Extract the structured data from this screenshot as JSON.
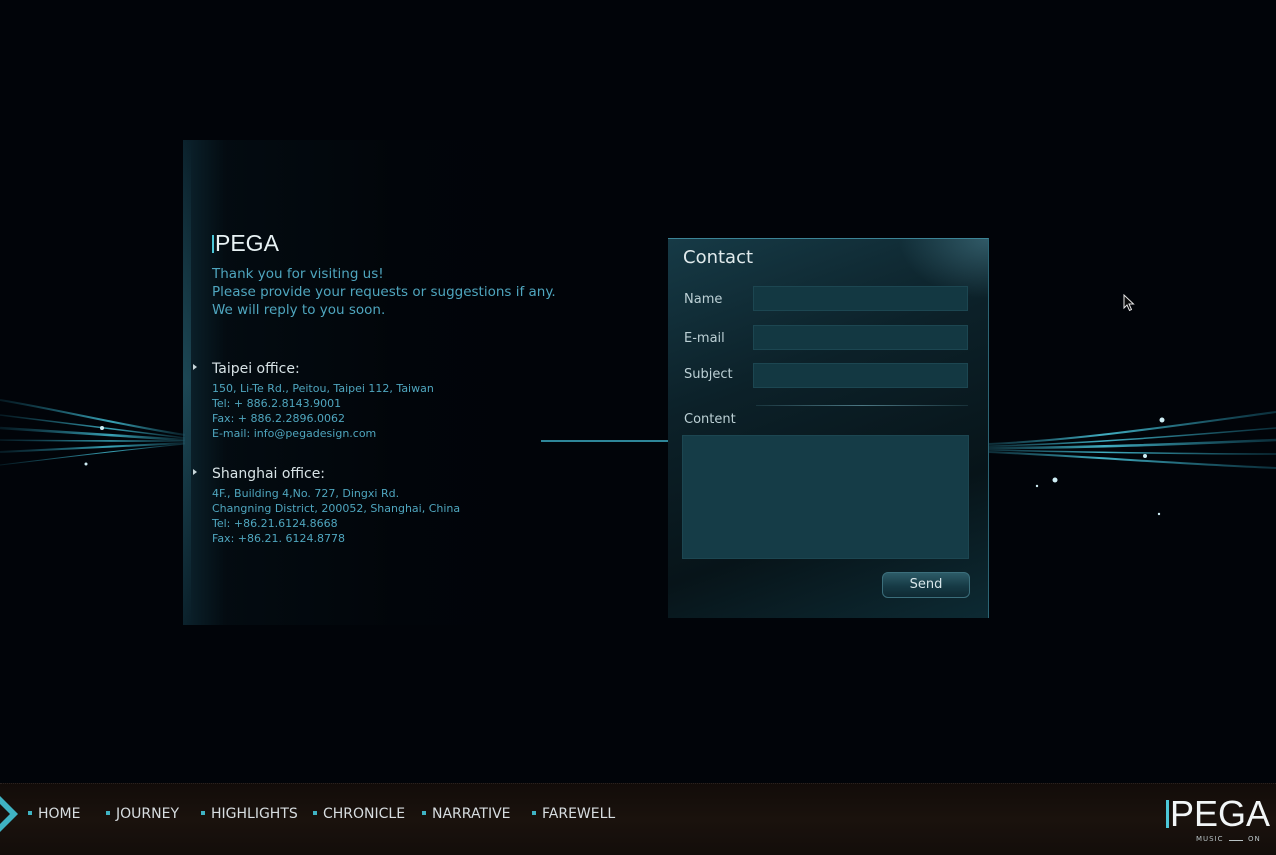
{
  "brand": {
    "logo_text": "PEGA"
  },
  "intro": {
    "line1": "Thank you for visiting us!",
    "line2": "Please provide your requests or suggestions if any.",
    "line3": "We will reply to you soon."
  },
  "offices": [
    {
      "title": "Taipei office:",
      "lines": [
        "150, Li-Te Rd., Peitou, Taipei 112, Taiwan",
        "Tel: + 886.2.8143.9001",
        "Fax: + 886.2.2896.0062",
        "E-mail: info@pegadesign.com"
      ]
    },
    {
      "title": "Shanghai office:",
      "lines": [
        "4F., Building 4,No. 727, Dingxi Rd.",
        "Changning District, 200052, Shanghai, China",
        "Tel: +86.21.6124.8668",
        "Fax: +86.21. 6124.8778"
      ]
    }
  ],
  "contact": {
    "title": "Contact",
    "name_label": "Name",
    "email_label": "E-mail",
    "subject_label": "Subject",
    "content_label": "Content",
    "name_value": "",
    "email_value": "",
    "subject_value": "",
    "content_value": "",
    "send_label": "Send"
  },
  "nav": {
    "items": [
      "HOME",
      "JOURNEY",
      "HIGHLIGHTS",
      "CHRONICLE",
      "NARRATIVE",
      "FAREWELL"
    ],
    "music_label": "MUSIC",
    "music_state": "ON"
  },
  "colors": {
    "accent": "#3fb3c3",
    "text_blue": "#4fa6bf",
    "background": "#010409"
  }
}
